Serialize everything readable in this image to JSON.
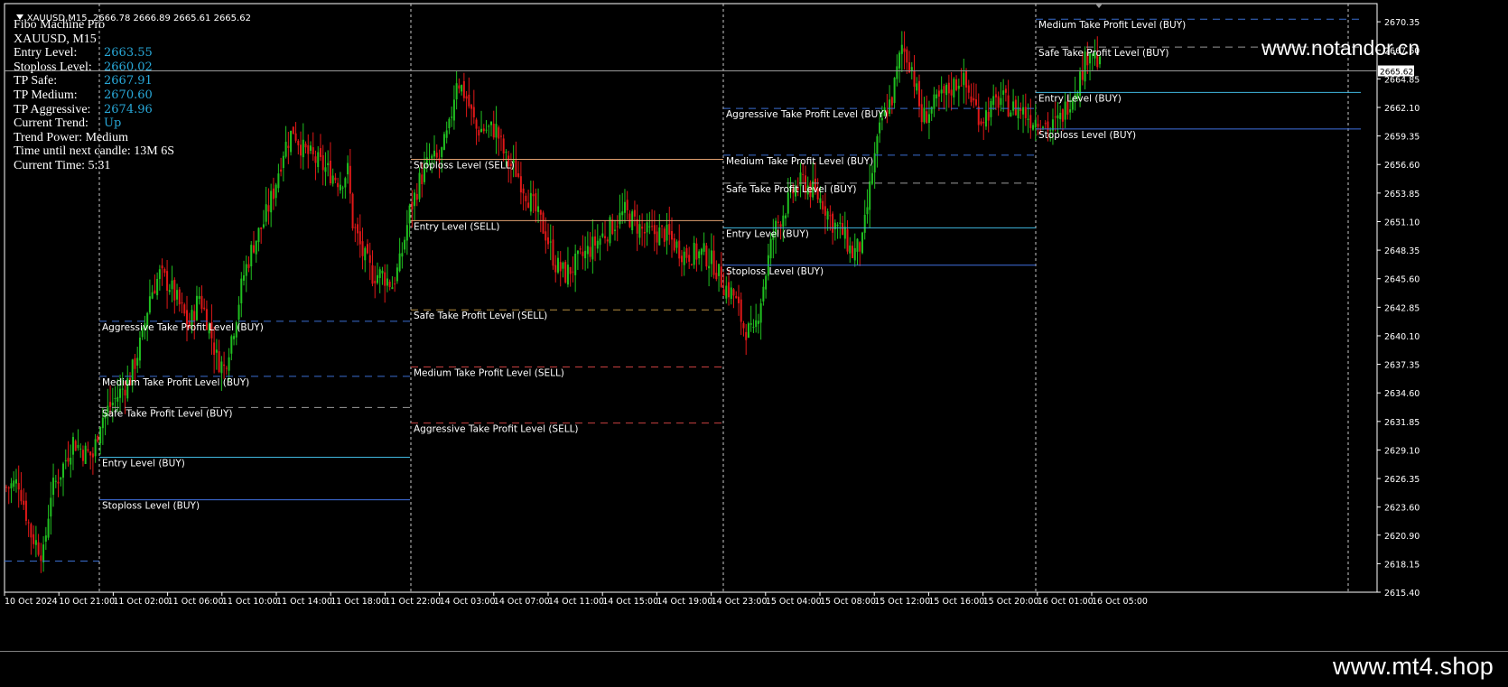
{
  "window": {
    "symbol_header": "XAUUSD,M15  2666.78 2666.89 2665.61 2665.62"
  },
  "indicator": {
    "title": "Fibo Machine Pro",
    "symbol_tf": "XAUUSD, M15",
    "rows": [
      {
        "label": "Entry Level:",
        "value": "2663.55"
      },
      {
        "label": "Stoploss Level:",
        "value": "2660.02"
      },
      {
        "label": "TP Safe:",
        "value": "2667.91"
      },
      {
        "label": "TP Medium:",
        "value": "2670.60"
      },
      {
        "label": "TP Aggressive:",
        "value": "2674.96"
      },
      {
        "label": "Current Trend:",
        "value": "Up"
      }
    ],
    "trend_power": "Trend Power: Medium",
    "time_until": "Time until next candle: 13M 6S",
    "current_time": "Current Time: 5:31"
  },
  "watermark": "www.notandor.cn",
  "footer": "www.mt4.shop",
  "colors": {
    "background": "#000000",
    "bull_candle": "#20c020",
    "bear_candle": "#e01818",
    "text_value": "#28a8d8",
    "buy_tp": "#3a6ed0",
    "sell_tp": "#c84040",
    "entry_buy": "#40b8e0",
    "stop_buy": "#4070e0",
    "entry_sell": "#e0a070",
    "stop_sell": "#e0a070",
    "safe_line": "#9a9a9a",
    "sell_safe": "#b89040"
  },
  "chart_data": {
    "type": "candlestick",
    "symbol": "XAUUSD",
    "timeframe": "M15",
    "current_price": "2665.62",
    "ylim": [
      2615.4,
      2672.1
    ],
    "y_ticks": [
      "2670.35",
      "2667.60",
      "2664.85",
      "2662.10",
      "2659.35",
      "2656.60",
      "2653.85",
      "2651.10",
      "2648.35",
      "2645.60",
      "2642.85",
      "2640.10",
      "2637.35",
      "2634.60",
      "2631.85",
      "2629.10",
      "2626.35",
      "2623.60",
      "2620.90",
      "2618.15",
      "2615.40"
    ],
    "x_ticks": [
      "10 Oct 2024",
      "10 Oct 21:00",
      "11 Oct 02:00",
      "11 Oct 06:00",
      "11 Oct 10:00",
      "11 Oct 14:00",
      "11 Oct 18:00",
      "11 Oct 22:00",
      "14 Oct 03:00",
      "14 Oct 07:00",
      "14 Oct 11:00",
      "14 Oct 15:00",
      "14 Oct 19:00",
      "14 Oct 23:00",
      "15 Oct 04:00",
      "15 Oct 08:00",
      "15 Oct 12:00",
      "15 Oct 16:00",
      "15 Oct 20:00",
      "16 Oct 01:00",
      "16 Oct 05:00"
    ],
    "price_path": [
      [
        0,
        2625.5
      ],
      [
        5,
        2626
      ],
      [
        10,
        2621
      ],
      [
        15,
        2619
      ],
      [
        18,
        2625
      ],
      [
        22,
        2627
      ],
      [
        27,
        2630
      ],
      [
        31,
        2629
      ],
      [
        35,
        2628.5
      ],
      [
        38,
        2632
      ],
      [
        44,
        2634
      ],
      [
        50,
        2636
      ],
      [
        55,
        2640
      ],
      [
        58,
        2644
      ],
      [
        62,
        2646
      ],
      [
        66,
        2645
      ],
      [
        70,
        2643
      ],
      [
        74,
        2641
      ],
      [
        78,
        2644
      ],
      [
        82,
        2641
      ],
      [
        85,
        2638
      ],
      [
        88,
        2637
      ],
      [
        92,
        2641
      ],
      [
        96,
        2646
      ],
      [
        100,
        2649
      ],
      [
        104,
        2651
      ],
      [
        108,
        2654
      ],
      [
        112,
        2658
      ],
      [
        116,
        2660
      ],
      [
        120,
        2658
      ],
      [
        125,
        2657
      ],
      [
        130,
        2656
      ],
      [
        135,
        2655
      ],
      [
        138,
        2656
      ],
      [
        140,
        2651
      ],
      [
        144,
        2648
      ],
      [
        148,
        2646
      ],
      [
        152,
        2646
      ],
      [
        156,
        2645
      ],
      [
        159,
        2647
      ],
      [
        163,
        2652
      ],
      [
        167,
        2655
      ],
      [
        171,
        2657
      ],
      [
        175,
        2657
      ],
      [
        179,
        2660
      ],
      [
        182,
        2665
      ],
      [
        186,
        2663
      ],
      [
        190,
        2660
      ],
      [
        194,
        2660
      ],
      [
        198,
        2660
      ],
      [
        202,
        2657
      ],
      [
        206,
        2656
      ],
      [
        210,
        2654
      ],
      [
        214,
        2652
      ],
      [
        218,
        2650
      ],
      [
        222,
        2647
      ],
      [
        226,
        2646
      ],
      [
        230,
        2647
      ],
      [
        234,
        2648
      ],
      [
        238,
        2649
      ],
      [
        242,
        2650
      ],
      [
        246,
        2651
      ],
      [
        250,
        2652
      ],
      [
        254,
        2651
      ],
      [
        258,
        2650
      ],
      [
        262,
        2650
      ],
      [
        266,
        2650
      ],
      [
        270,
        2649
      ],
      [
        274,
        2648
      ],
      [
        278,
        2648
      ],
      [
        282,
        2648
      ],
      [
        286,
        2647
      ],
      [
        290,
        2645
      ],
      [
        294,
        2644
      ],
      [
        298,
        2641
      ],
      [
        302,
        2640
      ],
      [
        306,
        2645
      ],
      [
        310,
        2650
      ],
      [
        314,
        2652
      ],
      [
        318,
        2654
      ],
      [
        322,
        2655
      ],
      [
        326,
        2654
      ],
      [
        330,
        2653
      ],
      [
        334,
        2651
      ],
      [
        338,
        2650
      ],
      [
        342,
        2648
      ],
      [
        346,
        2649
      ],
      [
        350,
        2656
      ],
      [
        354,
        2661
      ],
      [
        358,
        2663
      ],
      [
        362,
        2668
      ],
      [
        366,
        2666
      ],
      [
        370,
        2661
      ],
      [
        374,
        2662
      ],
      [
        378,
        2663
      ],
      [
        382,
        2664
      ],
      [
        386,
        2665
      ],
      [
        390,
        2663
      ],
      [
        394,
        2661
      ],
      [
        398,
        2662
      ],
      [
        402,
        2663
      ],
      [
        406,
        2662
      ],
      [
        410,
        2662
      ],
      [
        414,
        2661
      ],
      [
        418,
        2661
      ],
      [
        422,
        2660
      ],
      [
        426,
        2661
      ],
      [
        430,
        2663
      ],
      [
        434,
        2665
      ],
      [
        438,
        2668
      ],
      [
        442,
        2666
      ]
    ],
    "vertical_separators": [
      110,
      455,
      801,
      1147,
      1493
    ],
    "level_groups": [
      {
        "x1": 110,
        "x2": 454,
        "levels": [
          {
            "label": "Aggressive Take Profit Level (BUY)",
            "price": 2641.5,
            "style": "dash",
            "color_key": "buy_tp"
          },
          {
            "label": "Medium Take Profit Level (BUY)",
            "price": 2636.2,
            "style": "dash",
            "color_key": "buy_tp"
          },
          {
            "label": "Safe Take Profit Level (BUY)",
            "price": 2633.2,
            "style": "dash",
            "color_key": "safe_line"
          },
          {
            "label": "Entry Level (BUY)",
            "price": 2628.4,
            "style": "solid",
            "color_key": "entry_buy"
          },
          {
            "label": "Stoploss Level (BUY)",
            "price": 2624.3,
            "style": "solid",
            "color_key": "stop_buy"
          }
        ]
      },
      {
        "x1": 455,
        "x2": 801,
        "levels": [
          {
            "label": "Stoploss Level (SELL)",
            "price": 2657.1,
            "style": "solid",
            "color_key": "stop_sell"
          },
          {
            "label": "Entry Level (SELL)",
            "price": 2651.2,
            "style": "solid",
            "color_key": "entry_sell"
          },
          {
            "label": "Safe Take Profit Level (SELL)",
            "price": 2642.6,
            "style": "dash",
            "color_key": "sell_safe"
          },
          {
            "label": "Medium Take Profit Level (SELL)",
            "price": 2637.1,
            "style": "dash",
            "color_key": "sell_tp"
          },
          {
            "label": "Aggressive Take Profit Level (SELL)",
            "price": 2631.7,
            "style": "dash",
            "color_key": "sell_tp"
          }
        ]
      },
      {
        "x1": 801,
        "x2": 1147,
        "levels": [
          {
            "label": "Aggressive Take Profit Level (BUY)",
            "price": 2662.0,
            "style": "dash",
            "color_key": "buy_tp"
          },
          {
            "label": "Medium Take Profit Level (BUY)",
            "price": 2657.5,
            "style": "dash",
            "color_key": "buy_tp"
          },
          {
            "label": "Safe Take Profit Level (BUY)",
            "price": 2654.8,
            "style": "dash",
            "color_key": "safe_line"
          },
          {
            "label": "Entry Level (BUY)",
            "price": 2650.5,
            "style": "solid",
            "color_key": "entry_buy"
          },
          {
            "label": "Stoploss Level (BUY)",
            "price": 2646.9,
            "style": "solid",
            "color_key": "stop_buy"
          }
        ]
      },
      {
        "x1": 1147,
        "x2": 1507,
        "levels": [
          {
            "label": "Medium Take Profit Level (BUY)",
            "price": 2670.6,
            "style": "dash",
            "color_key": "buy_tp"
          },
          {
            "label": "Safe Take Profit Level (BUY)",
            "price": 2667.91,
            "style": "dash",
            "color_key": "safe_line"
          },
          {
            "label": "Entry Level (BUY)",
            "price": 2663.55,
            "style": "solid",
            "color_key": "entry_buy"
          },
          {
            "label": "Stoploss Level (BUY)",
            "price": 2660.02,
            "style": "solid",
            "color_key": "stop_buy"
          }
        ]
      }
    ],
    "left_stub_level": {
      "price": 2618.4,
      "style": "dash",
      "color_key": "buy_tp",
      "x1": 5,
      "x2": 110
    }
  }
}
